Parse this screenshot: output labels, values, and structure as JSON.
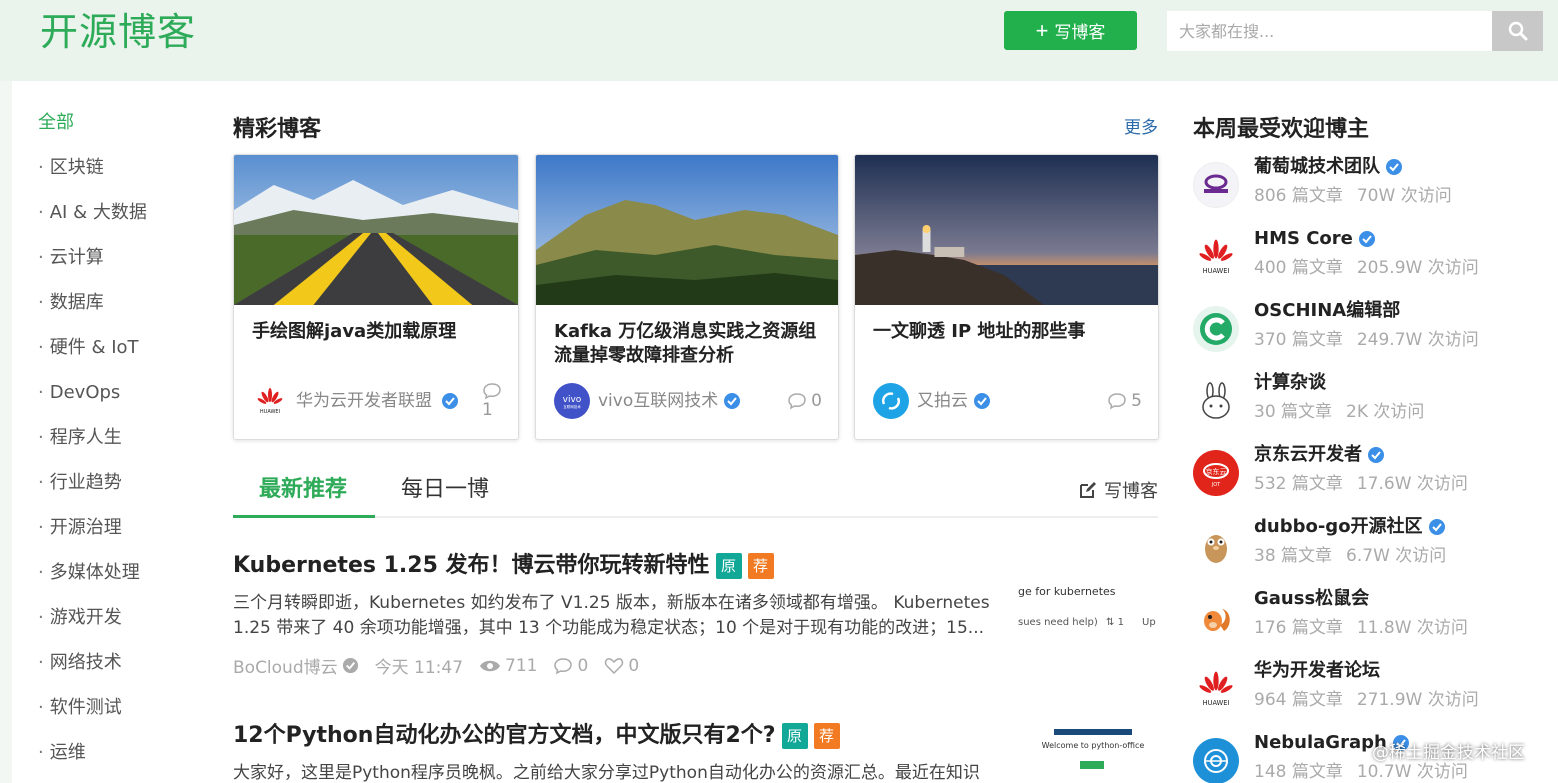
{
  "header": {
    "logo": "开源博客",
    "write_button": "写博客",
    "search_placeholder": "大家都在搜...",
    "accent": "#21b04b"
  },
  "sidebar": {
    "items": [
      "全部",
      "区块链",
      "AI & 大数据",
      "云计算",
      "数据库",
      "硬件 & IoT",
      "DevOps",
      "程序人生",
      "行业趋势",
      "开源治理",
      "多媒体处理",
      "游戏开发",
      "网络技术",
      "软件测试",
      "运维"
    ]
  },
  "featured": {
    "title": "精彩博客",
    "more": "更多",
    "cards": [
      {
        "title": "手绘图解java类加载原理",
        "author": "华为云开发者联盟",
        "comments": "1"
      },
      {
        "title": "Kafka 万亿级消息实践之资源组流量掉零故障排查分析",
        "author": "vivo互联网技术",
        "comments": "0"
      },
      {
        "title": "一文聊透 IP 地址的那些事",
        "author": "又拍云",
        "comments": "5"
      }
    ]
  },
  "tabs": {
    "latest": "最新推荐",
    "daily": "每日一博",
    "write": "写博客"
  },
  "articles": [
    {
      "title": "Kubernetes 1.25 发布！博云带你玩转新特性",
      "badge_original": "原",
      "badge_recommend": "荐",
      "summary": "三个月转瞬即逝，Kubernetes 如约发布了 V1.25 版本，新版本在诸多领域都有增强。 Kubernetes 1.25 带来了 40 余项功能增强，其中 13 个功能成为稳定状态；10 个是对于现有功能的改进；15...",
      "author": "BoCloud博云",
      "time": "今天 11:47",
      "views": "711",
      "comments": "0",
      "likes": "0",
      "thumb_line1": "ge for kubernetes",
      "thumb_line2": "sues need help)",
      "thumb_line3": "1",
      "thumb_line4": "Up"
    },
    {
      "title": "12个Python自动化办公的官方文档，中文版只有2个?",
      "badge_original": "原",
      "badge_recommend": "荐",
      "summary": "大家好，这里是Python程序员晚枫。之前给大家分享过Python自动化办公的资源汇总。最近在知识",
      "thumb_text": "Welcome to python-office"
    }
  ],
  "popular": {
    "title": "本周最受欢迎博主",
    "bloggers": [
      {
        "name": "葡萄城技术团队",
        "articles": "806 篇文章",
        "visits": "70W 次访问",
        "verified": true
      },
      {
        "name": "HMS Core",
        "articles": "400 篇文章",
        "visits": "205.9W 次访问",
        "verified": true
      },
      {
        "name": "OSCHINA编辑部",
        "articles": "370 篇文章",
        "visits": "249.7W 次访问",
        "verified": false
      },
      {
        "name": "计算杂谈",
        "articles": "30 篇文章",
        "visits": "2K 次访问",
        "verified": false
      },
      {
        "name": "京东云开发者",
        "articles": "532 篇文章",
        "visits": "17.6W 次访问",
        "verified": true
      },
      {
        "name": "dubbo-go开源社区",
        "articles": "38 篇文章",
        "visits": "6.7W 次访问",
        "verified": true
      },
      {
        "name": "Gauss松鼠会",
        "articles": "176 篇文章",
        "visits": "11.8W 次访问",
        "verified": false
      },
      {
        "name": "华为开发者论坛",
        "articles": "964 篇文章",
        "visits": "271.9W 次访问",
        "verified": false
      },
      {
        "name": "NebulaGraph",
        "articles": "148 篇文章",
        "visits": "10.7W 次访问",
        "verified": true
      }
    ]
  },
  "watermark": "@稀土掘金技术社区"
}
